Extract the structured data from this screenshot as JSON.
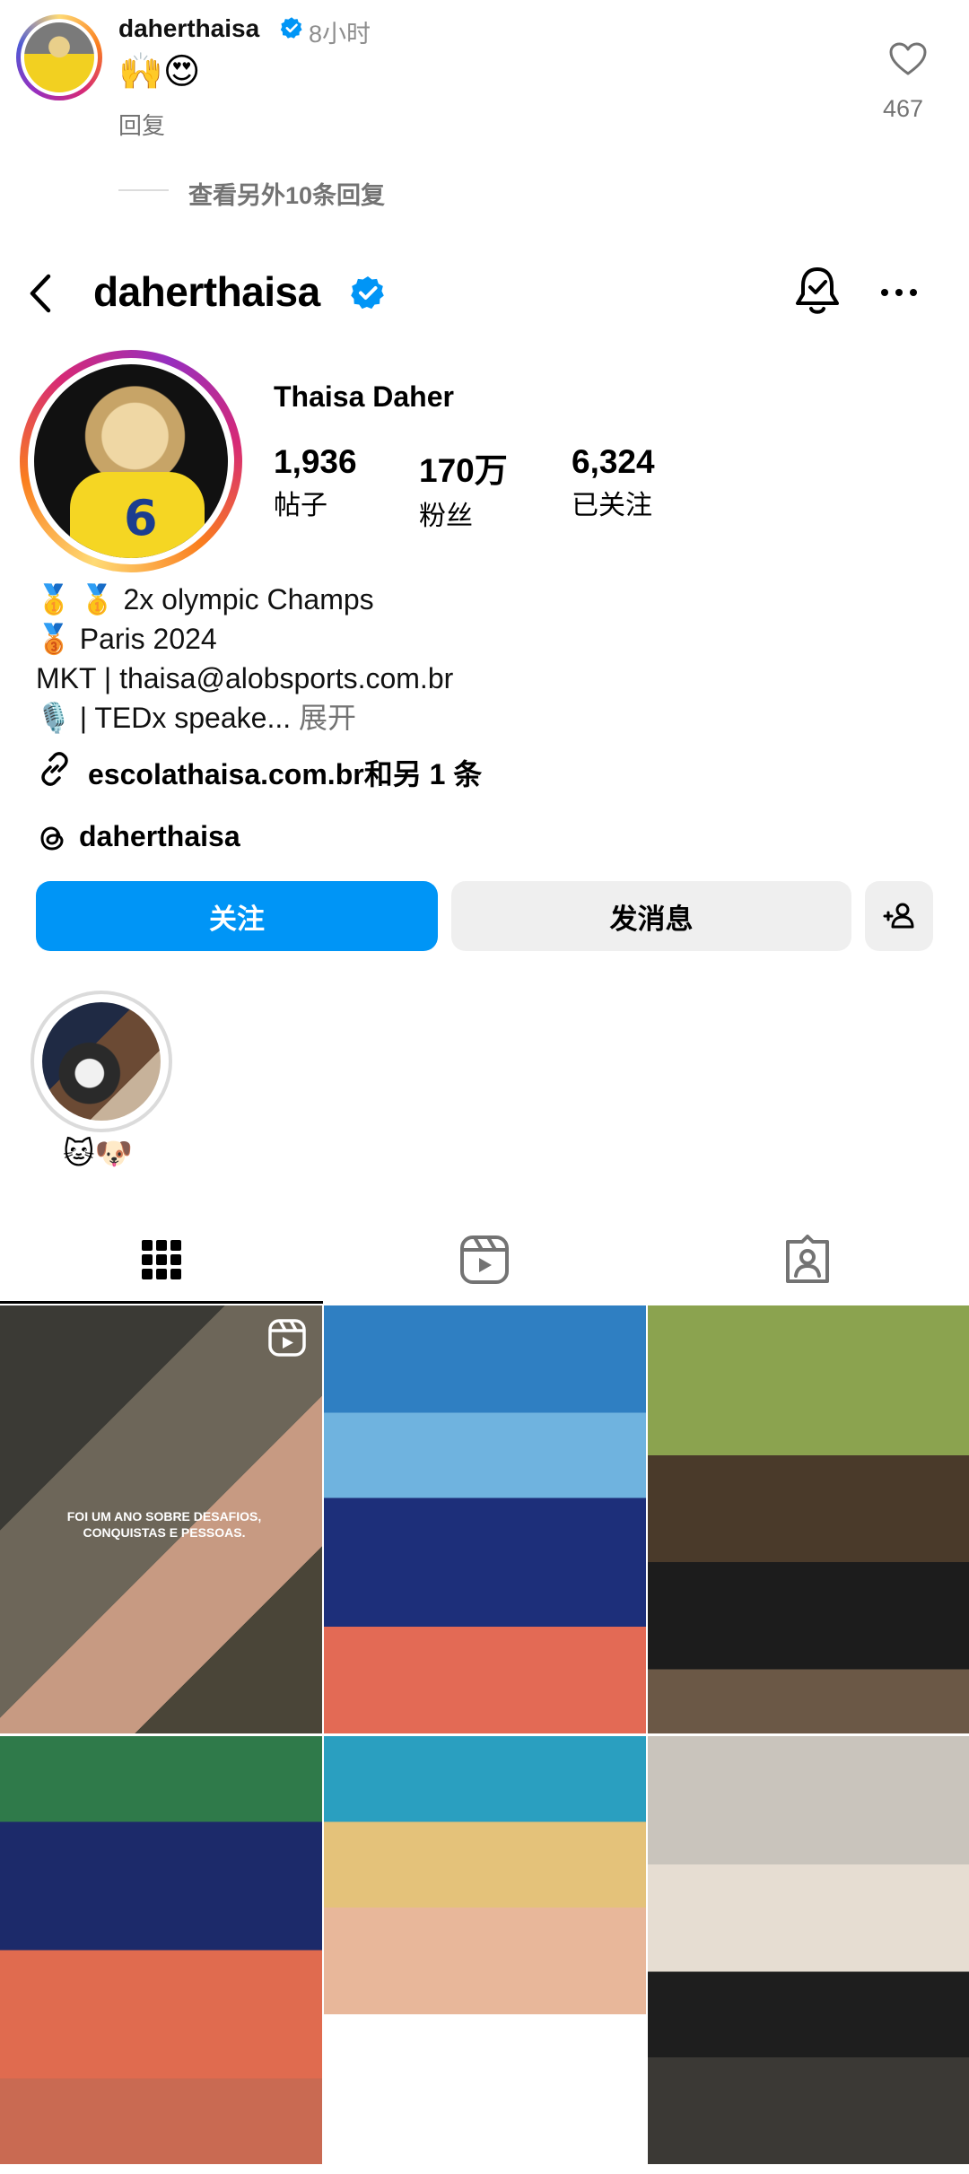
{
  "comment": {
    "username": "daherthaisa",
    "time": "8小时",
    "text": "🙌😍",
    "reply_label": "回复",
    "like_count": "467",
    "view_more": "查看另外10条回复"
  },
  "header": {
    "username": "daherthaisa"
  },
  "profile": {
    "display_name": "Thaisa Daher",
    "stats": [
      {
        "value": "1,936",
        "label": "帖子"
      },
      {
        "value": "170万",
        "label": "粉丝"
      },
      {
        "value": "6,324",
        "label": "已关注"
      }
    ],
    "bio": [
      "🥇 🥇 2x olympic Champs",
      "🥉 Paris 2024",
      "MKT | thaisa@alobsports.com.br",
      "🎙️ | TEDx speake..."
    ],
    "bio_more": "展开",
    "link_text": "escolathaisa.com.br和另 1 条",
    "threads_handle": "daherthaisa"
  },
  "actions": {
    "follow": "关注",
    "message": "发消息"
  },
  "highlights": [
    {
      "label": "🐱🐶"
    }
  ],
  "posts": {
    "first_caption": "FOI UM ANO SOBRE DESAFIOS, CONQUISTAS E PESSOAS."
  },
  "colors": {
    "accent": "#0095f6",
    "verified": "#0095f6",
    "secondary_text": "#737373"
  }
}
